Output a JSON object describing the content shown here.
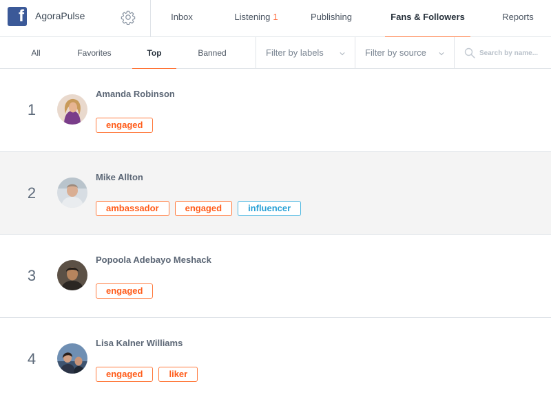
{
  "app": {
    "name": "AgoraPulse",
    "logo_letter": "f",
    "accent": "#ff6c2c",
    "brand_color": "#3b5998"
  },
  "nav": {
    "inbox": "Inbox",
    "listening": "Listening",
    "listening_count": "1",
    "publishing": "Publishing",
    "fans": "Fans & Followers",
    "reports": "Reports",
    "settings_icon": "gear-icon"
  },
  "subnav": {
    "all": "All",
    "favorites": "Favorites",
    "top": "Top",
    "banned": "Banned",
    "filter_labels": "Filter by labels",
    "filter_source": "Filter by source",
    "search_placeholder": "Search by name..."
  },
  "fans": [
    {
      "rank": "1",
      "name": "Amanda Robinson",
      "tags": [
        "engaged"
      ]
    },
    {
      "rank": "2",
      "name": "Mike Allton",
      "tags": [
        "ambassador",
        "engaged",
        "influencer"
      ]
    },
    {
      "rank": "3",
      "name": "Popoola Adebayo Meshack",
      "tags": [
        "engaged"
      ]
    },
    {
      "rank": "4",
      "name": "Lisa Kalner Williams",
      "tags": [
        "engaged",
        "liker"
      ]
    }
  ]
}
